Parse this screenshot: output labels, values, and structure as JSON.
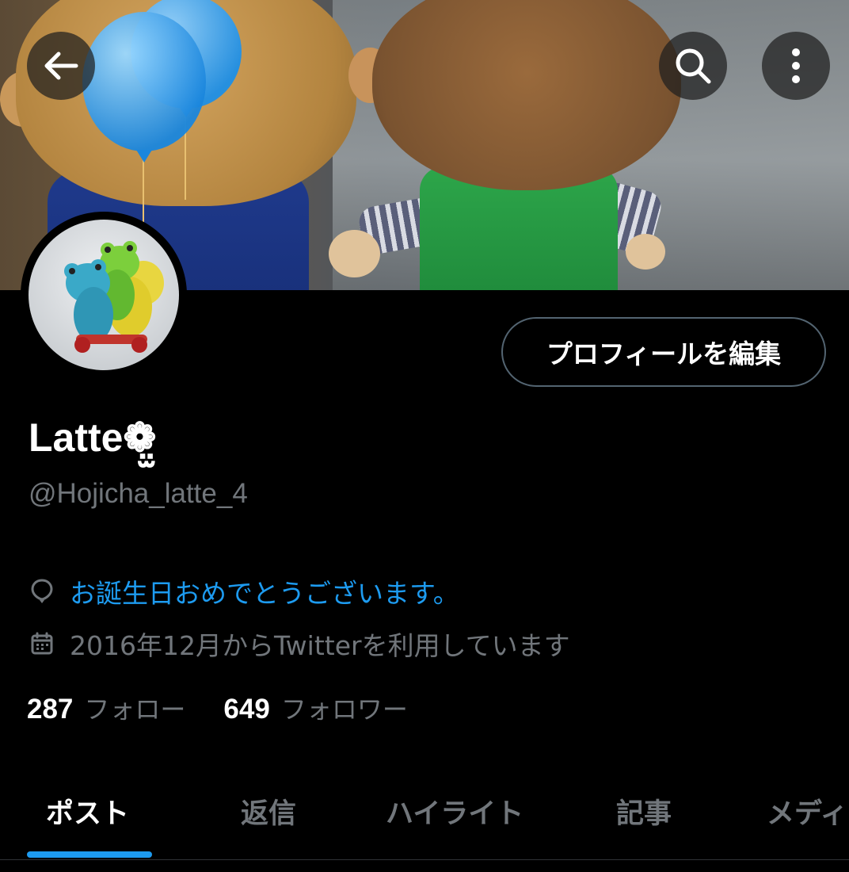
{
  "header": {
    "back_icon": "arrow-left-icon",
    "search_icon": "search-icon",
    "more_icon": "more-vertical-icon"
  },
  "profile": {
    "edit_button_label": "プロフィールを編集",
    "display_name": "Latte❁̤̫",
    "handle": "@Hojicha_latte_4",
    "birthday_text": "お誕生日おめでとうございます。",
    "joined_text": "2016年12月からTwitterを利用しています",
    "following_count": "287",
    "following_label": "フォロー",
    "followers_count": "649",
    "followers_label": "フォロワー"
  },
  "tabs": [
    {
      "label": "ポスト",
      "active": true
    },
    {
      "label": "返信",
      "active": false
    },
    {
      "label": "ハイライト",
      "active": false
    },
    {
      "label": "記事",
      "active": false
    },
    {
      "label": "メディ",
      "active": false
    }
  ],
  "colors": {
    "accent": "#1d9bf0",
    "secondary_text": "#71767b",
    "background": "#000000"
  }
}
